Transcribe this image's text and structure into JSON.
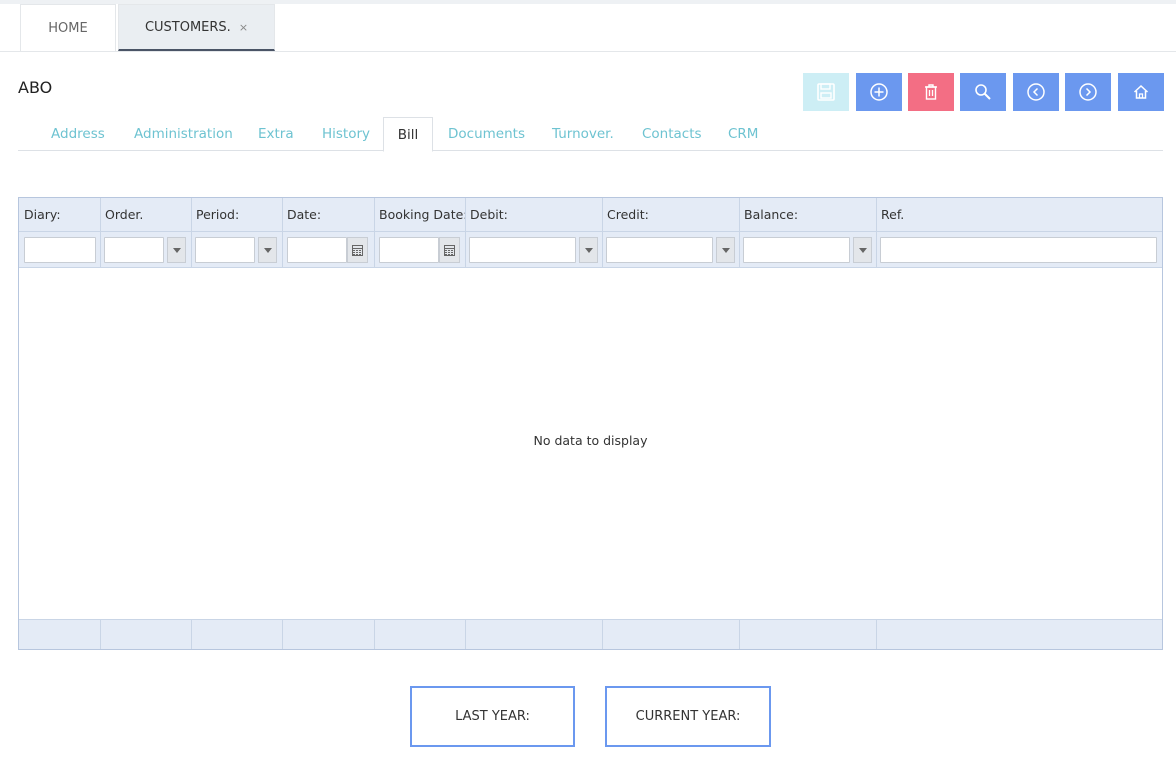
{
  "app_tabs": {
    "home": "HOME",
    "customers": "CUSTOMERS.",
    "close": "×"
  },
  "record": {
    "title": "ABO"
  },
  "toolbar": {
    "icons": [
      "save-icon",
      "plus-circle-icon",
      "trash-icon",
      "search-icon",
      "chevron-left-icon",
      "chevron-right-icon",
      "home-icon"
    ],
    "colors": {
      "save": "#cdeef5",
      "primary": "#6b98ef",
      "danger": "#f36e84"
    }
  },
  "sub_tabs": [
    "Address",
    "Administration",
    "Extra",
    "History",
    "Bill",
    "Documents",
    "Turnover.",
    "Contacts",
    "CRM"
  ],
  "active_sub_tab": "Bill",
  "grid": {
    "columns": [
      "Diary:",
      "Order.",
      "Period:",
      "Date:",
      "Booking Date:",
      "Debit:",
      "Credit:",
      "Balance:",
      "Ref."
    ],
    "empty_message": "No data to display"
  },
  "summary_buttons": {
    "last_year": "LAST YEAR:",
    "current_year": "CURRENT YEAR:"
  }
}
